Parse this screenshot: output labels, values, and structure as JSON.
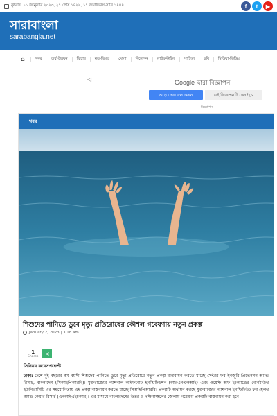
{
  "topbar": {
    "date": "বুধবার, ১১ জানুয়ারি ২০২৩, ২৭ পৌষ ১৪২৯, ১৭ জমাদিউস-সানি ১৪৪৪",
    "social": {
      "facebook": "f",
      "twitter": "t",
      "youtube": "▶"
    }
  },
  "header": {
    "logo_main": "সারাবাংলা",
    "logo_sub": "sarabangla.net",
    "bg": "#1f6fb8"
  },
  "nav": {
    "home_icon": "⌂",
    "items": [
      "খবর",
      "অর্থ-উন্নয়ন",
      "ফিচার",
      "মত-দ্বিমত",
      "খেলা",
      "বিনোদন",
      "লাইফস্টাইল",
      "সাহিত্য",
      "ছবি",
      "মিডিয়া-ভিডিও"
    ]
  },
  "ad": {
    "google_word": "Google",
    "by_ad": "দ্বারা বিজ্ঞাপন",
    "stop_label": "আড় দেখা বন্ধ করুন",
    "why_label": "এই বিজ্ঞাপনটি কেন? ▷",
    "label": "বিজ্ঞাপন",
    "adchoice": "◁"
  },
  "article": {
    "category": "খবর",
    "title": "শিশুদের পানিতে ডুবে মৃত্যু প্রতিরোধের কৌশল গবেষণায় নতুন প্রকল্প",
    "date": "January 2, 2023 | 3:18 am",
    "share_count": "1",
    "share_label": "Shares",
    "share_icon": "<",
    "byline": "সিনিয়র করেসপন্ডেন্ট",
    "dateline": "ঢাকা:",
    "body": " দেশে দুই বছরের কম বয়সী শিশুদের পানিতে ডুবে মৃত্যু প্রতিরোধে নতুন প্রকল্প বাস্তবায়ন করতে যাচ্ছে সেন্টার ফর ইনজুরি প্রিভেনশন অ্যান্ড রিসার্চ, বাংলাদেশ (সিআইপিআরবি)। যুক্তরাজ্যের ন্যাশনাল লাইফবোট ইনস্টিটিউশন (আরএনএলআই) এবং ওয়েস্ট অফ ইংল্যান্ডের বোর্নমাউথ ইউনিভার্সিটি এর সহযোগিতায় এই প্রকল্প বাস্তবায়ন করতে যাচ্ছে সিআইপিআরবি। প্রকল্পটি অর্থায়ন করছে যুক্তরাজ্যের ন্যাশনাল ইনস্টিটিউট ফর হেলথ অ্যান্ড কেয়ার রিসার্চ (এনআইএইচআর)। এর মাধ্যমে বাংলাদেশের উত্তর ও দক্ষিণাঞ্চলের জেলায় গবেষণা প্রকল্পটি বাস্তবায়ন করা হবে।"
  }
}
